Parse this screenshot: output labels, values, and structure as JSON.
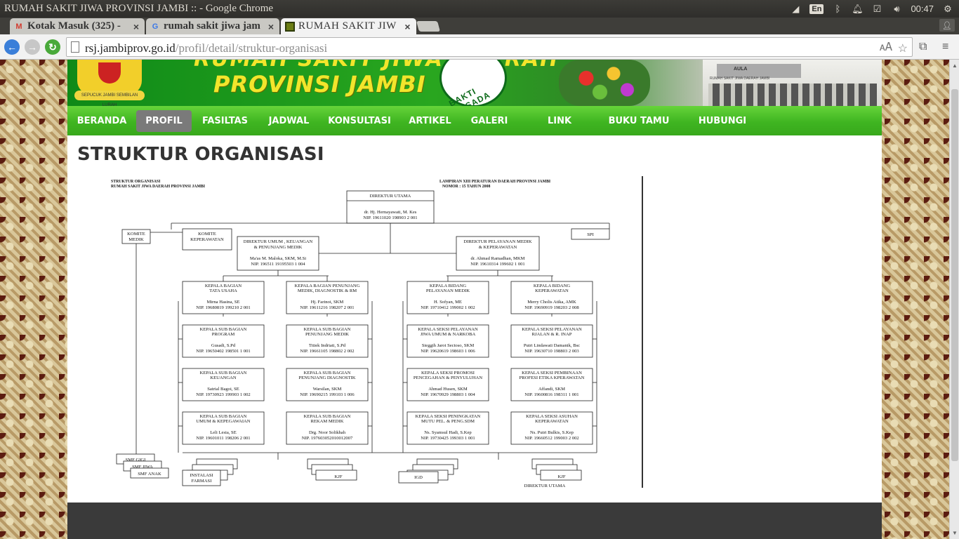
{
  "window": {
    "title": "RUMAH SAKIT JIWA PROVINSI JAMBI :: - Google Chrome",
    "tray": {
      "lang": "En",
      "time": "00:47"
    }
  },
  "tabs": [
    {
      "label": "Kotak Masuk (325) - ",
      "favicon": "gmail-icon"
    },
    {
      "label": "rumah sakit jiwa jam",
      "favicon": "google-icon"
    },
    {
      "label": "RUMAH SAKIT JIW",
      "favicon": "site-icon"
    }
  ],
  "toolbar": {
    "url_host": "rsj.jambiprov.go.id",
    "url_path": "/profil/detail/struktur-organisasi"
  },
  "banner": {
    "name_line1": "RUMAH SAKIT JIWA DAERAH",
    "name_line2": "PROVINSI JAMBI",
    "crest_motto": "SEPUCUK JAMBI SEMBILAN LURAH",
    "emblem_text": "BAKTI HUSADA",
    "building_sign": "AULA",
    "building_caption": "RUMAH SAKIT JIWA DAERAH JAMBI"
  },
  "nav": {
    "items": [
      "BERANDA",
      "PROFIL",
      "FASILTAS",
      "JADWAL",
      "KONSULTASI",
      "ARTIKEL",
      "GALERI",
      "LINK TERKAIT",
      "BUKU TAMU",
      "HUBUNGI KAMI"
    ],
    "active": "PROFIL"
  },
  "page": {
    "title": "STRUKTUR ORGANISASI"
  },
  "chart_heading": {
    "left1": "STRUKTUR ORGANISASI",
    "left2": "RUMAH SAKIT JIWA DAERAH PROVINSI JAMBI",
    "right1": "LAMPIRAN XIII PERATURAN DAERAH PROVINSI JAMBI",
    "right2": "NOMOR : 15 TAHUN 2008"
  },
  "org": {
    "direktur": {
      "title": "DIREKTUR UTAMA",
      "name": "dr. Hj. Hernayawati, M. Kes",
      "nip": "NIP. 19611020  198903  2 001"
    },
    "komite_medik": "KOMITE MEDIK",
    "komite_keperawatan": "KOMITE KEPERAWATAN",
    "spi": "SPI",
    "dir_umum": {
      "title1": "DIREKTUR UMUM , KEUANGAN",
      "title2": "& PENUNJANG MEDIK",
      "name": "Ma'as M. Maloka, SKM, M.Si",
      "nip": "NIP. 196511 19195503 1 004"
    },
    "dir_pelayanan": {
      "title1": "DIREKTUR PELAYANAN MEDIK",
      "title2": "& KEPERAWATAN",
      "name": "dr. Ahmad Ramadhan, MKM",
      "nip": "NIP. 19610314  199602  1 001"
    },
    "columns": [
      [
        {
          "t1": "KEPALA BAGIAN",
          "t2": "TATA USAHA",
          "name": "Mirna Hasina, SE",
          "nip": "NIP. 19680819  199210  2 001"
        },
        {
          "t1": "KEPALA SUB BAGIAN",
          "t2": "PROGRAM",
          "name": "Gusadi, S.Pd",
          "nip": "NIP. 19650402  198501  1 001"
        },
        {
          "t1": "KEPALA SUB BAGIAN",
          "t2": "KEUANGAN",
          "name": "Satrial Bagoi, SE",
          "nip": "NIP. 19730923  199903  1 002"
        },
        {
          "t1": "KEPALA SUB BAGIAN",
          "t2": "UMUM & KEPEGAWAIAN",
          "name": "Leli Lesia, SE",
          "nip": "NIP. 19601011  198206  2 001"
        }
      ],
      [
        {
          "t1": "KEPALA BAGIAN PENUNJANG",
          "t2": "MEDIK, DIAGNOSTIK  & RM",
          "name": "Hj. Farinoi, SKM",
          "nip": "NIP. 19611216  198207  2 001"
        },
        {
          "t1": "KEPALA SUB BAGIAN",
          "t2": "PENUNJANG MEDIK",
          "name": "Titiek Indriati, S.Pd",
          "nip": "NIP. 19661105  198802  2 002"
        },
        {
          "t1": "KEPALA SUB BAGIAN",
          "t2": "PENUNJANG DIAGNOSTIK",
          "name": "Warsilan, SKM",
          "nip": "NIP. 19690215  199103  1 006"
        },
        {
          "t1": "KEPALA SUB BAGIAN",
          "t2": "REKAM MEDIK",
          "name": "Drg. Noor Solikhah",
          "nip": "NIP. 197603052010012007"
        }
      ],
      [
        {
          "t1": "KEPALA BIDANG",
          "t2": "PELAYANAN MEDIK",
          "name": "H. Sofyan, ME",
          "nip": "NIP. 19710412 199002 1 002"
        },
        {
          "t1": "KEPALA SEKSI PELAYANAN",
          "t2": "JIWA UMUM & NARKOBA",
          "name": "Sieggih Jarot Sectoso, SKM",
          "nip": "NIP. 19620619  198603  1 006"
        },
        {
          "t1": "KEPALA SEKSI PROMOSI",
          "t2": "PENCEGAHAN & PENYULUHAN",
          "name": "Ahmad Husen, SKM",
          "nip": "NIP. 19670929  198803  1 004"
        },
        {
          "t1": "KEPALA SEKSI PENINGKATAN",
          "t2": "MUTU PEL. & PENG.SDM",
          "name": "Ns. Syamsul Hadi, S.Kep",
          "nip": "NIP. 19730425  199303  1 001"
        }
      ],
      [
        {
          "t1": "KEPALA BIDANG",
          "t2": "KEPERAWATAN",
          "name": "Merry Cholis Atika, AMK",
          "nip": "NIP. 19690919  198203  2 008"
        },
        {
          "t1": "KEPALA SEKSI PELAYANAN",
          "t2": "RJALAN & R. INAP",
          "name": "Putri Lindawati Damanik, Bsc",
          "nip": "NIP. 19630710  198803  2 003"
        },
        {
          "t1": "KEPALA SEKSI PEMBINAAN",
          "t2": "PROFESI ETIKA KPERAWATAN",
          "name": "Affandi, SKM",
          "nip": "NIP. 19600816  198311  1 001"
        },
        {
          "t1": "KEPALA SEKSI ASUHAN",
          "t2": "KEPERAWATAN",
          "name": "Ns. Putri Bulkis, S.Kep",
          "nip": "NIP. 19660512  199003  2 002"
        }
      ]
    ],
    "bottom": {
      "smf_gigi": "SMF GIGI",
      "smf_jiwa": "SMF JIWA",
      "smf_anak": "SMF ANAK",
      "instalasi1": "INSTALASI",
      "instalasi2": "FARMASI",
      "kjf": "KJF",
      "igd": "IGD",
      "direktur_sign": "DIREKTUR UTAMA"
    }
  }
}
